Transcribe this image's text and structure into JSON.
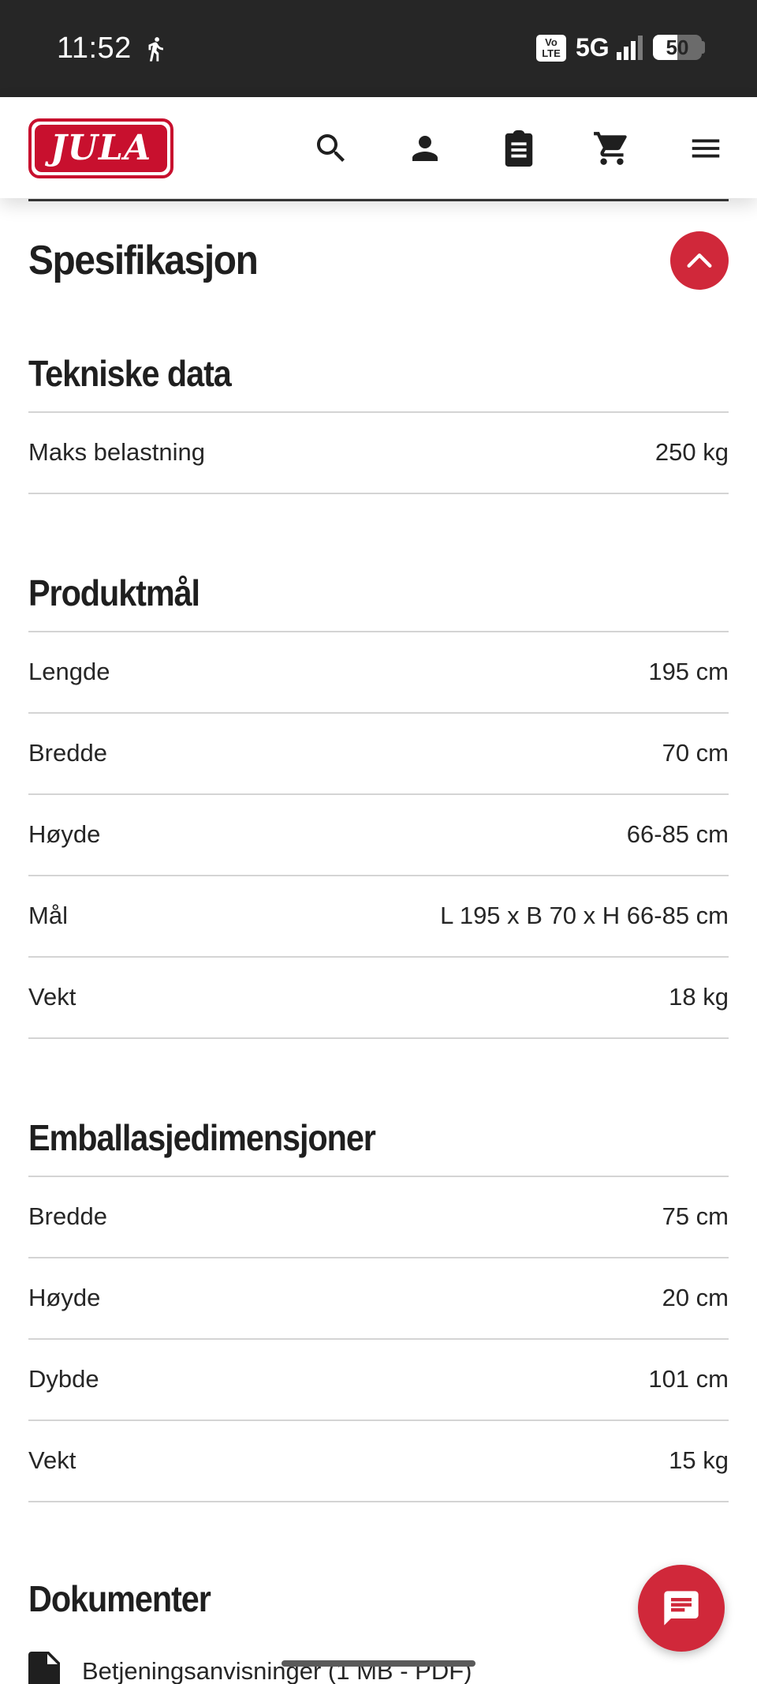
{
  "status_bar": {
    "time": "11:52",
    "volte": "Vo\nLTE",
    "network": "5G",
    "battery": "50",
    "battery_level": 0.5
  },
  "header": {
    "logo_text": "JULA",
    "icons": [
      "search-icon",
      "account-icon",
      "clipboard-icon",
      "cart-icon",
      "menu-icon"
    ]
  },
  "specs": {
    "title": "Spesifikasjon",
    "groups": [
      {
        "title": "Tekniske data",
        "rows": [
          {
            "label": "Maks belastning",
            "value": "250 kg"
          }
        ]
      },
      {
        "title": "Produktmål",
        "rows": [
          {
            "label": "Lengde",
            "value": "195 cm"
          },
          {
            "label": "Bredde",
            "value": "70 cm"
          },
          {
            "label": "Høyde",
            "value": "66-85 cm"
          },
          {
            "label": "Mål",
            "value": "L 195 x B 70 x H 66-85 cm"
          },
          {
            "label": "Vekt",
            "value": "18 kg"
          }
        ]
      },
      {
        "title": "Emballasjedimensjoner",
        "rows": [
          {
            "label": "Bredde",
            "value": "75 cm"
          },
          {
            "label": "Høyde",
            "value": "20 cm"
          },
          {
            "label": "Dybde",
            "value": "101 cm"
          },
          {
            "label": "Vekt",
            "value": "15 kg"
          }
        ]
      }
    ]
  },
  "documents": {
    "title": "Dokumenter",
    "items": [
      {
        "label": "Betjeningsanvisninger (1 MB - PDF)"
      }
    ]
  },
  "colors": {
    "accent": "#d0283a",
    "status_bar": "#262626",
    "divider": "#d4d4d4"
  }
}
